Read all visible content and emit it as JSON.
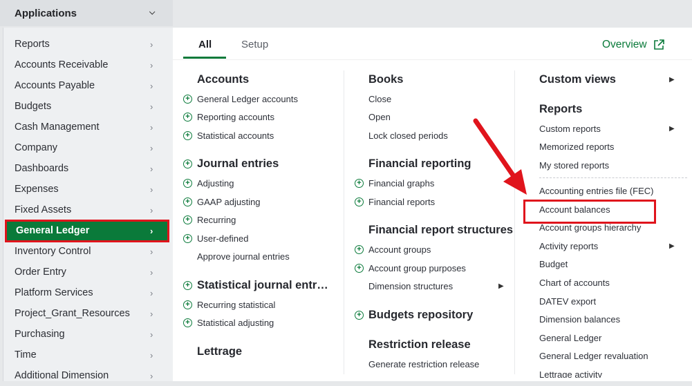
{
  "topbar": {
    "apps_label": "Applications"
  },
  "sidebar": {
    "items": [
      {
        "label": "Reports"
      },
      {
        "label": "Accounts Receivable"
      },
      {
        "label": "Accounts Payable"
      },
      {
        "label": "Budgets"
      },
      {
        "label": "Cash Management"
      },
      {
        "label": "Company"
      },
      {
        "label": "Dashboards"
      },
      {
        "label": "Expenses"
      },
      {
        "label": "Fixed Assets"
      },
      {
        "label": "General Ledger",
        "active": true
      },
      {
        "label": "Inventory Control"
      },
      {
        "label": "Order Entry"
      },
      {
        "label": "Platform Services"
      },
      {
        "label": "Project_Grant_Resources"
      },
      {
        "label": "Purchasing"
      },
      {
        "label": "Time"
      },
      {
        "label": "Additional Dimension"
      }
    ]
  },
  "tabs": {
    "all": "All",
    "setup": "Setup"
  },
  "overview_label": "Overview",
  "col1": {
    "accounts": {
      "heading": "Accounts",
      "items": [
        "General Ledger accounts",
        "Reporting accounts",
        "Statistical accounts"
      ]
    },
    "journal": {
      "heading": "Journal entries",
      "items": [
        "Adjusting",
        "GAAP adjusting",
        "Recurring",
        "User-defined"
      ],
      "approve": "Approve journal entries"
    },
    "statistical": {
      "heading": "Statistical journal entr…",
      "items": [
        "Recurring statistical",
        "Statistical adjusting"
      ]
    },
    "lettrage": {
      "heading": "Lettrage"
    }
  },
  "col2": {
    "books": {
      "heading": "Books",
      "items": [
        "Close",
        "Open",
        "Lock closed periods"
      ]
    },
    "financial_reporting": {
      "heading": "Financial reporting",
      "items": [
        "Financial graphs",
        "Financial reports"
      ]
    },
    "structures": {
      "heading": "Financial report structures",
      "items": [
        "Account groups",
        "Account group purposes"
      ],
      "dimension": "Dimension structures"
    },
    "budgets_repo": {
      "heading": "Budgets repository"
    },
    "restriction": {
      "heading": "Restriction release",
      "items": [
        "Generate restriction release"
      ]
    }
  },
  "col3": {
    "custom_views": {
      "heading": "Custom views"
    },
    "reports": {
      "heading": "Reports",
      "items": [
        "Custom reports",
        "Memorized reports",
        "My stored reports"
      ]
    },
    "report_list": [
      "Accounting entries file (FEC)",
      "Account balances",
      "Account groups hierarchy",
      "Activity reports",
      "Budget",
      "Chart of accounts",
      "DATEV export",
      "Dimension balances",
      "General Ledger",
      "General Ledger revaluation",
      "Lettrage activity"
    ]
  },
  "colors": {
    "accent": "#0a7a3a",
    "highlight": "#e0141c"
  }
}
